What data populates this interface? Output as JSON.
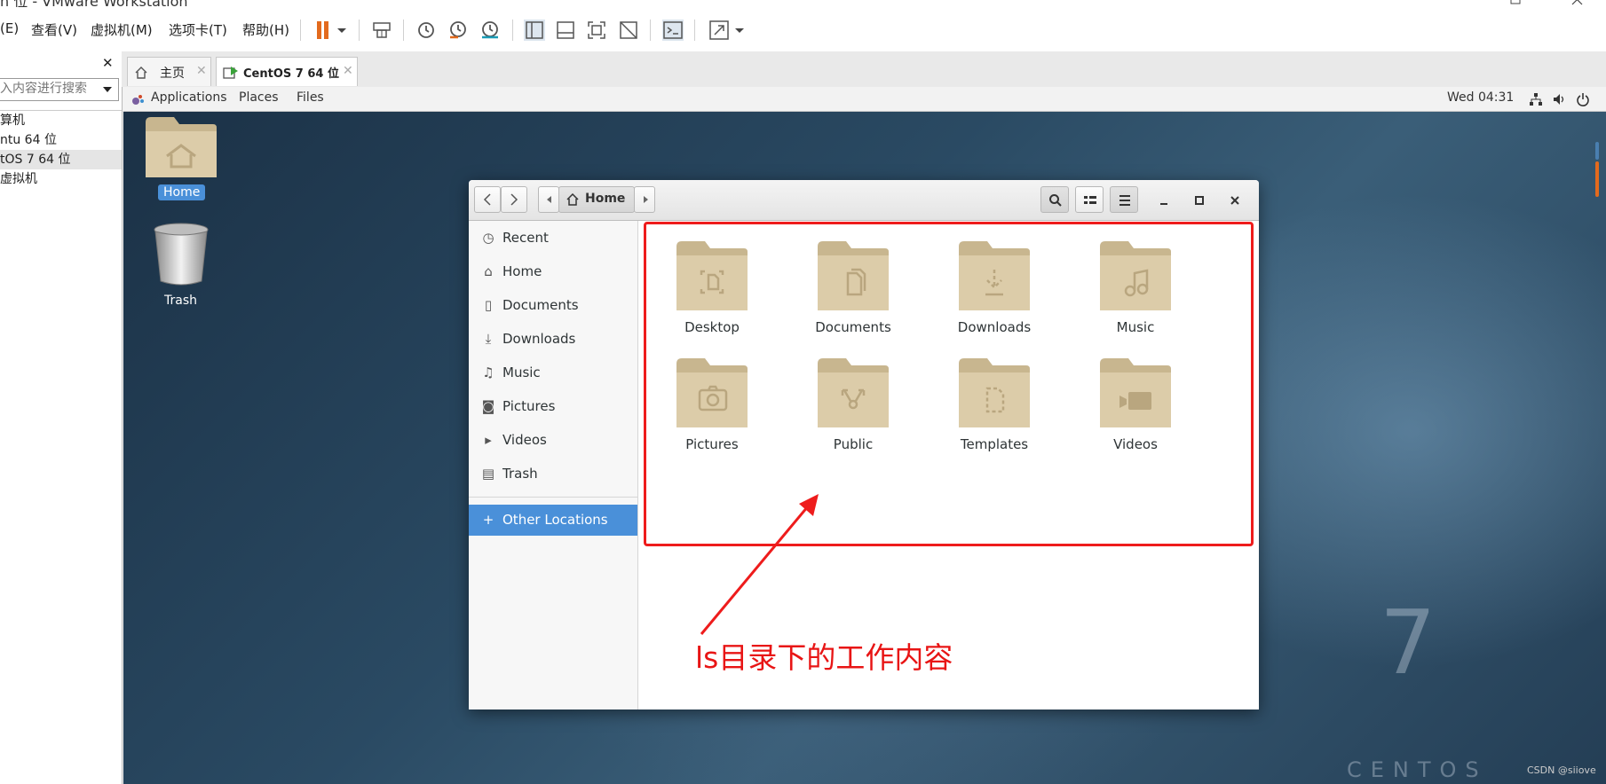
{
  "window": {
    "title": "n 位 - VMware Workstation"
  },
  "menubar": {
    "items": [
      "(E)",
      "查看(V)",
      "虚拟机(M)",
      "选项卡(T)",
      "帮助(H)"
    ]
  },
  "library": {
    "close_label": "✕",
    "search_placeholder": "入内容进行搜索",
    "items": [
      "算机",
      "ntu 64 位",
      "tOS 7 64 位",
      "虚拟机"
    ]
  },
  "tabs": [
    {
      "label": "主页"
    },
    {
      "label": "CentOS 7 64 位"
    }
  ],
  "gnome": {
    "applications": "Applications",
    "places": "Places",
    "files": "Files",
    "clock": "Wed 04:31"
  },
  "desktop": {
    "icons": [
      "Home",
      "Trash"
    ],
    "brand_number": "7",
    "brand_text": "CENTOS"
  },
  "nautilus": {
    "path": "Home",
    "sidebar": [
      "Recent",
      "Home",
      "Documents",
      "Downloads",
      "Music",
      "Pictures",
      "Videos",
      "Trash"
    ],
    "other_locations": "Other Locations",
    "folders": [
      "Desktop",
      "Documents",
      "Downloads",
      "Music",
      "Pictures",
      "Public",
      "Templates",
      "Videos"
    ]
  },
  "annotation": {
    "text": "ls目录下的工作内容",
    "color": "#ee1c1c"
  },
  "watermark": "CSDN @siiove",
  "colors": {
    "accent": "#4a90d9",
    "pause": "#e36a1d",
    "folder": "#dccca9"
  }
}
